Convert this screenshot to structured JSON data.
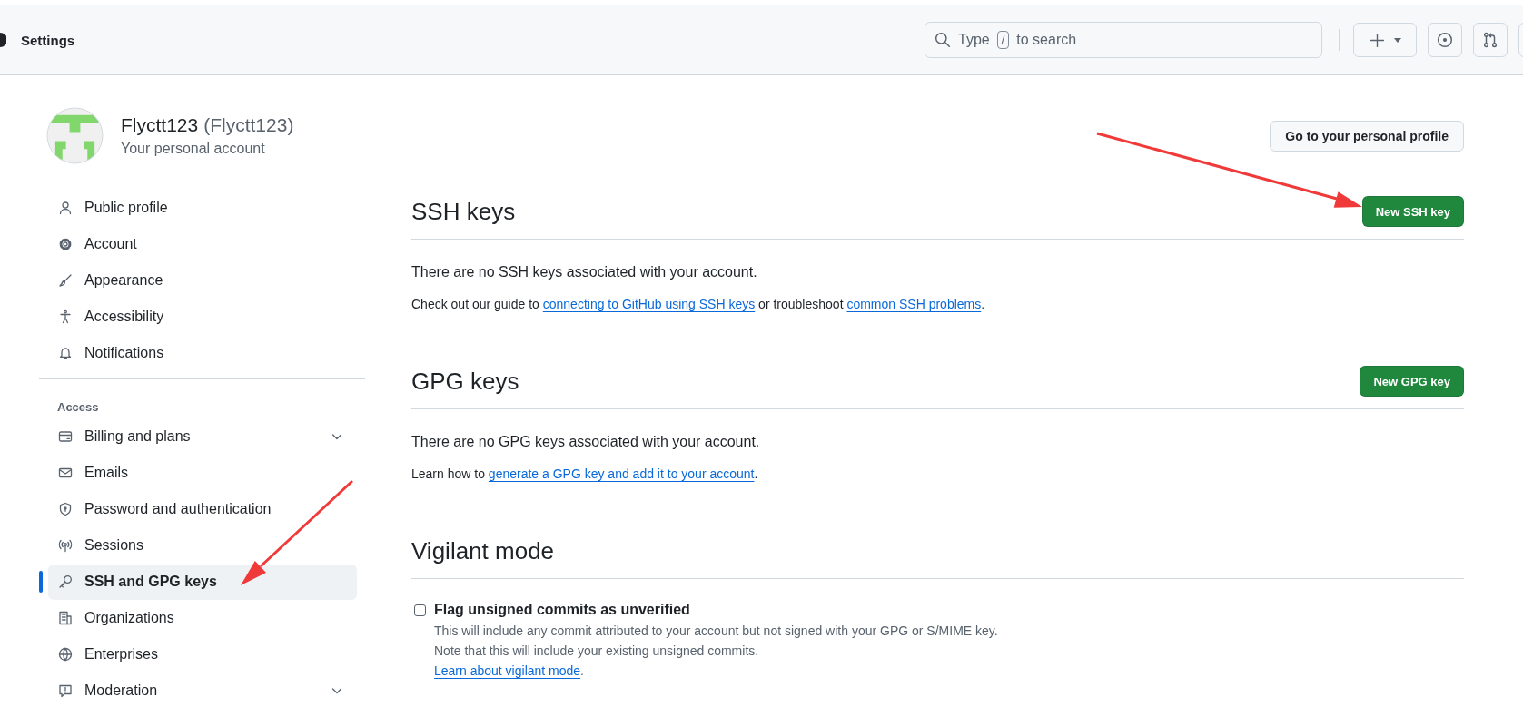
{
  "header": {
    "title": "Settings",
    "search": {
      "prefix": "Type",
      "shortcut": "/",
      "suffix": "to search"
    }
  },
  "account": {
    "name": "Flyctt123",
    "login": "(Flyctt123)",
    "subtitle": "Your personal account",
    "profile_button": "Go to your personal profile"
  },
  "sidebar": {
    "groups": [
      {
        "items": [
          {
            "label": "Public profile",
            "selected": false,
            "expandable": false
          },
          {
            "label": "Account",
            "selected": false,
            "expandable": false
          },
          {
            "label": "Appearance",
            "selected": false,
            "expandable": false
          },
          {
            "label": "Accessibility",
            "selected": false,
            "expandable": false
          },
          {
            "label": "Notifications",
            "selected": false,
            "expandable": false
          }
        ]
      },
      {
        "heading": "Access",
        "items": [
          {
            "label": "Billing and plans",
            "selected": false,
            "expandable": true
          },
          {
            "label": "Emails",
            "selected": false,
            "expandable": false
          },
          {
            "label": "Password and authentication",
            "selected": false,
            "expandable": false
          },
          {
            "label": "Sessions",
            "selected": false,
            "expandable": false
          },
          {
            "label": "SSH and GPG keys",
            "selected": true,
            "expandable": false
          },
          {
            "label": "Organizations",
            "selected": false,
            "expandable": false
          },
          {
            "label": "Enterprises",
            "selected": false,
            "expandable": false
          },
          {
            "label": "Moderation",
            "selected": false,
            "expandable": true
          }
        ]
      }
    ]
  },
  "sections": [
    {
      "title": "SSH keys",
      "button": "New SSH key",
      "message": "There are no SSH keys associated with your account.",
      "help": [
        {
          "kind": "text",
          "text": "Check out our guide to "
        },
        {
          "kind": "link",
          "text": "connecting to GitHub using SSH keys"
        },
        {
          "kind": "text",
          "text": " or troubleshoot "
        },
        {
          "kind": "link",
          "text": "common SSH problems"
        },
        {
          "kind": "text",
          "text": "."
        }
      ]
    },
    {
      "title": "GPG keys",
      "button": "New GPG key",
      "message": "There are no GPG keys associated with your account.",
      "help": [
        {
          "kind": "text",
          "text": "Learn how to "
        },
        {
          "kind": "link",
          "text": "generate a GPG key and add it to your account"
        },
        {
          "kind": "text",
          "text": "."
        }
      ]
    }
  ],
  "vigilant": {
    "title": "Vigilant mode",
    "checkbox": {
      "label": "Flag unsigned commits as unverified",
      "checked": false
    },
    "description": [
      "This will include any commit attributed to your account but not signed with your GPG or S/MIME key.",
      "Note that this will include your existing unsigned commits."
    ],
    "link": "Learn about vigilant mode",
    "link_suffix": "."
  }
}
